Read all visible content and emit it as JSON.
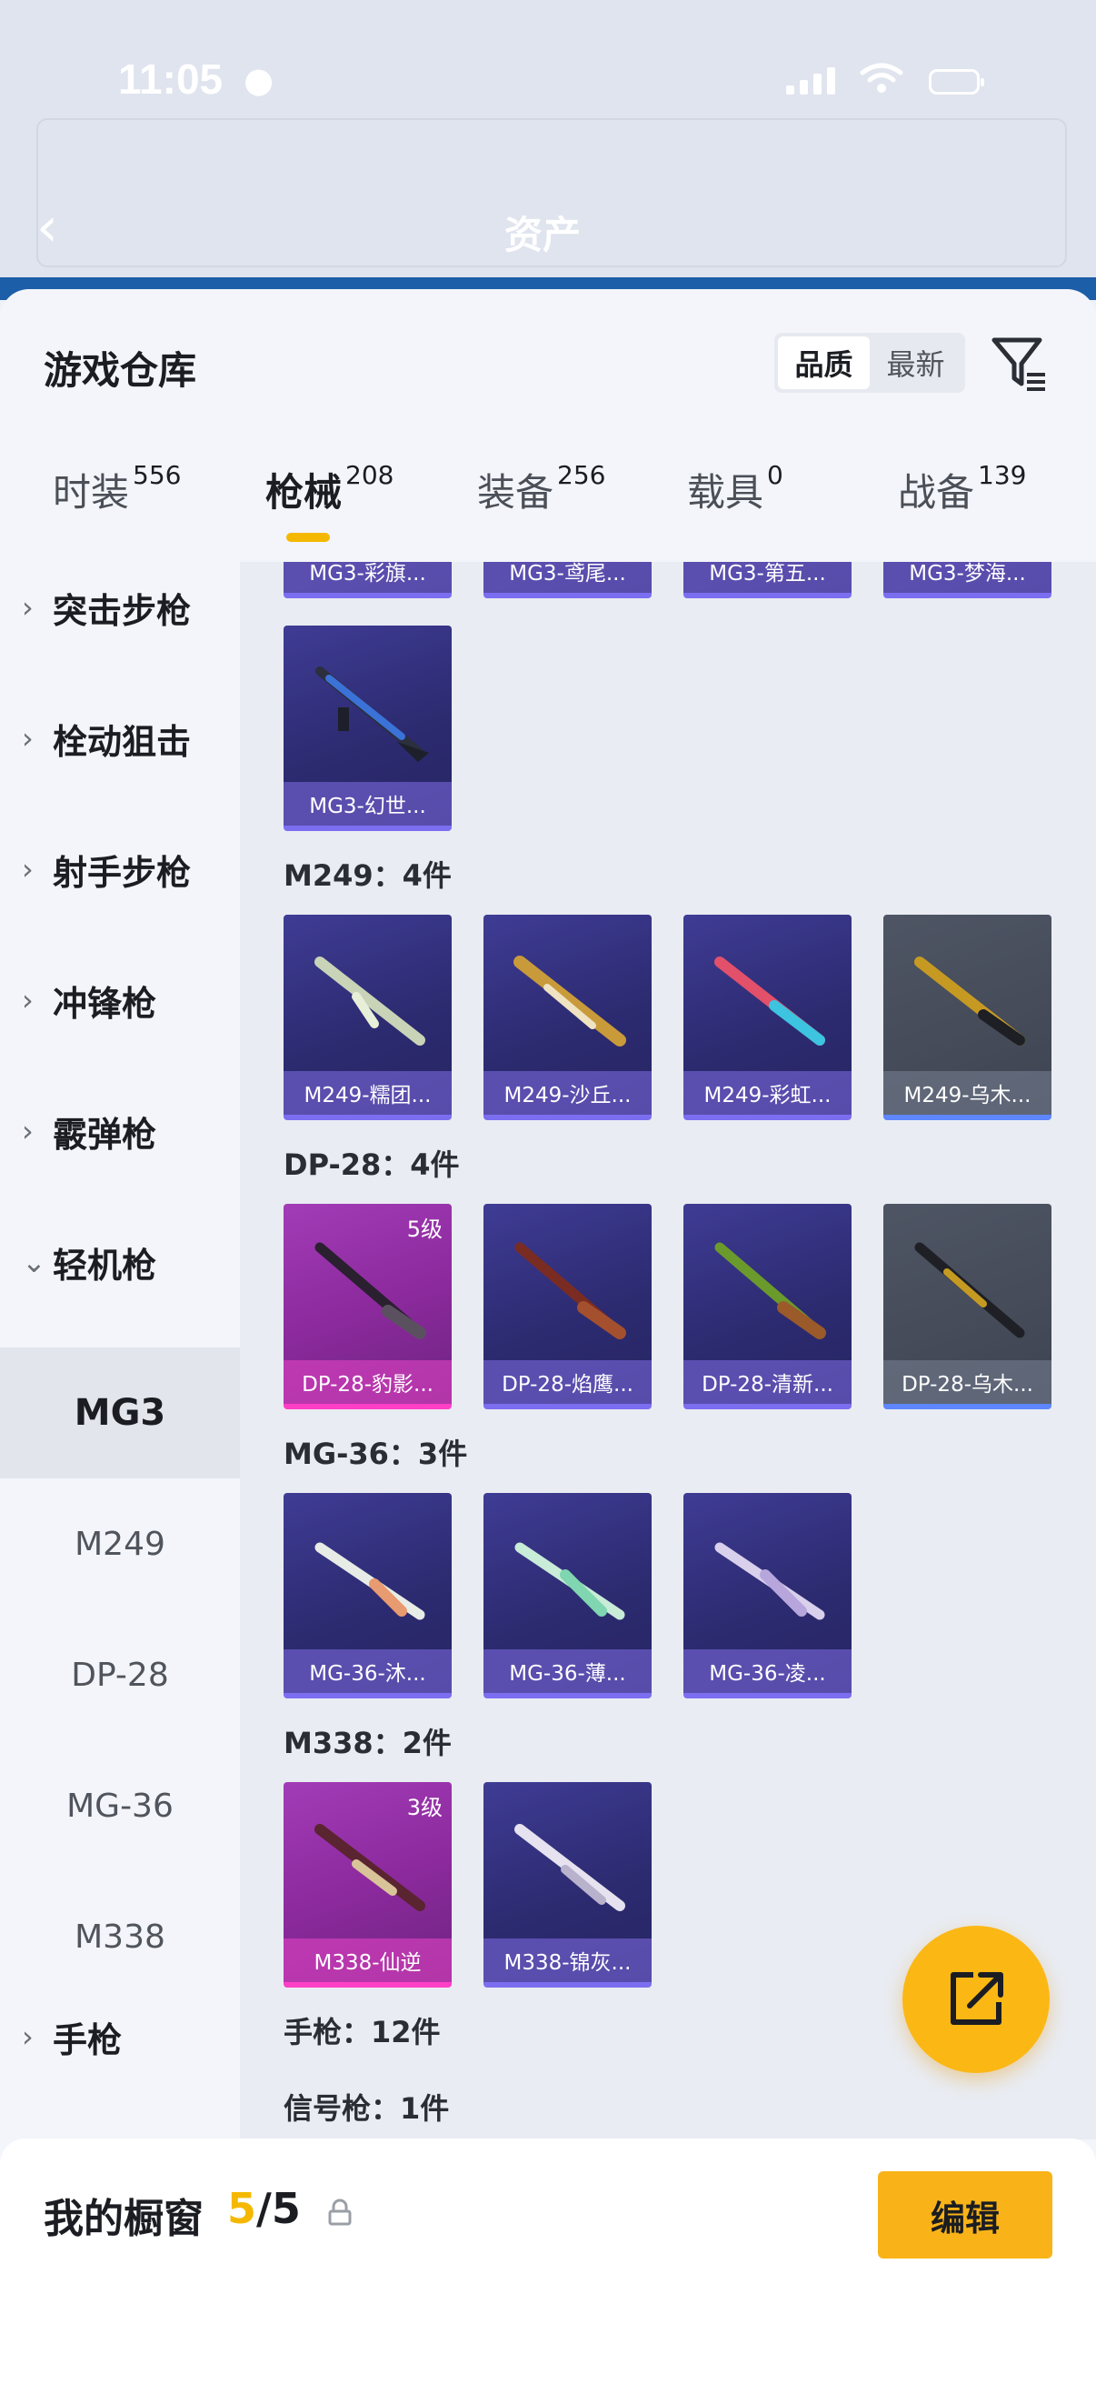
{
  "status_bar": {
    "time": "11:05"
  },
  "nav": {
    "title": "资产"
  },
  "sheet": {
    "title": "游戏仓库",
    "sort": [
      "品质",
      "最新"
    ],
    "tabs": [
      {
        "label": "时装",
        "count": "556"
      },
      {
        "label": "枪械",
        "count": "208"
      },
      {
        "label": "装备",
        "count": "256"
      },
      {
        "label": "载具",
        "count": "0"
      },
      {
        "label": "战备",
        "count": "139"
      }
    ]
  },
  "sidebar": {
    "categories": [
      "突击步枪",
      "栓动狙击",
      "射手步枪",
      "冲锋枪",
      "霰弹枪",
      "轻机枪"
    ],
    "subcategories": [
      "MG3",
      "M249",
      "DP-28",
      "MG-36",
      "M338"
    ],
    "pistol": "手枪"
  },
  "content": {
    "top_row": [
      "MG3-彩旗...",
      "MG3-鸢尾...",
      "MG3-第五...",
      "MG3-梦海..."
    ],
    "mg3_item": "MG3-幻世...",
    "groups": [
      {
        "title": "M249：4件",
        "items": [
          {
            "name": "M249-糯团...",
            "tier": "purple"
          },
          {
            "name": "M249-沙丘...",
            "tier": "purple"
          },
          {
            "name": "M249-彩虹...",
            "tier": "purple"
          },
          {
            "name": "M249-乌木...",
            "tier": "grey"
          }
        ]
      },
      {
        "title": "DP-28：4件",
        "items": [
          {
            "name": "DP-28-豹影...",
            "tier": "pink",
            "level": "5级"
          },
          {
            "name": "DP-28-焰鹰...",
            "tier": "purple"
          },
          {
            "name": "DP-28-清新...",
            "tier": "purple"
          },
          {
            "name": "DP-28-乌木...",
            "tier": "grey"
          }
        ]
      },
      {
        "title": "MG-36：3件",
        "items": [
          {
            "name": "MG-36-沐...",
            "tier": "purple"
          },
          {
            "name": "MG-36-薄...",
            "tier": "purple"
          },
          {
            "name": "MG-36-凌...",
            "tier": "purple"
          }
        ]
      },
      {
        "title": "M338：2件",
        "items": [
          {
            "name": "M338-仙逆",
            "tier": "pink",
            "level": "3级"
          },
          {
            "name": "M338-锦灰...",
            "tier": "purple"
          }
        ]
      }
    ],
    "pistol_group": "手枪：12件",
    "flare_group": "信号枪：1件"
  },
  "bottom": {
    "title": "我的橱窗",
    "current": "5",
    "total": "/5",
    "edit": "编辑"
  }
}
